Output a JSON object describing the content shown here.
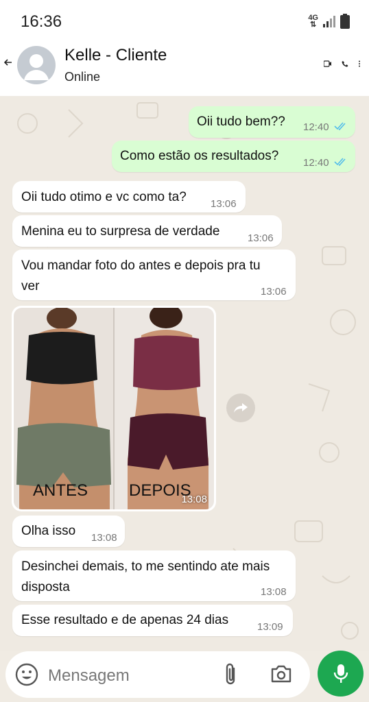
{
  "status_bar": {
    "time": "16:36",
    "network": "4G"
  },
  "header": {
    "contact_name": "Kelle - Cliente",
    "presence": "Online"
  },
  "messages": [
    {
      "dir": "out",
      "text": "Oii tudo bem??",
      "time": "12:40"
    },
    {
      "dir": "out",
      "text": "Como estão os resultados?",
      "time": "12:40"
    },
    {
      "dir": "in",
      "text": "Oii tudo otimo e vc como ta?",
      "time": "13:06"
    },
    {
      "dir": "in",
      "text": "Menina eu to surpresa de verdade",
      "time": "13:06"
    },
    {
      "dir": "in",
      "text": "Vou mandar foto do antes e depois pra tu ver",
      "time": "13:06"
    },
    {
      "dir": "in",
      "type": "image",
      "caption_left": "ANTES",
      "caption_right": "DEPOIS",
      "time": "13:08"
    },
    {
      "dir": "in",
      "text": "Olha isso",
      "time": "13:08"
    },
    {
      "dir": "in",
      "text": "Desinchei demais, to me sentindo ate mais disposta",
      "time": "13:08"
    },
    {
      "dir": "in",
      "text": "Esse resultado e de apenas 24 dias",
      "time": "13:09"
    }
  ],
  "composer": {
    "placeholder": "Mensagem"
  },
  "icons": {
    "back": "arrow-left-icon",
    "video": "video-call-icon",
    "phone": "phone-icon",
    "more": "more-vert-icon",
    "emoji": "emoji-icon",
    "attach": "paperclip-icon",
    "camera": "camera-icon",
    "mic": "microphone-icon",
    "forward": "forward-icon"
  },
  "colors": {
    "outgoing_bubble": "#d9fdd3",
    "incoming_bubble": "#ffffff",
    "mic_button": "#1da851",
    "read_ticks": "#53bdeb",
    "chat_bg": "#efeae2"
  }
}
